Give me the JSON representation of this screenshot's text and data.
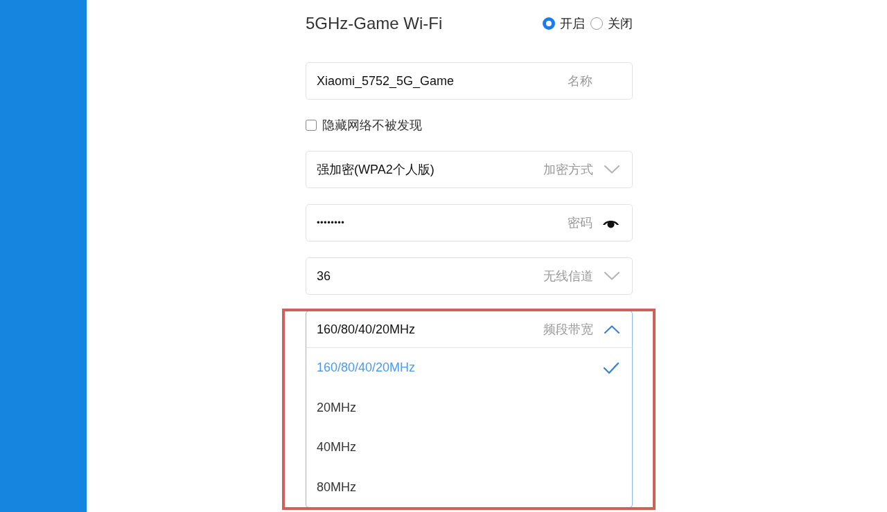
{
  "section": {
    "title": "5GHz-Game Wi-Fi",
    "power_options": [
      {
        "label": "开启",
        "selected": true
      },
      {
        "label": "关闭",
        "selected": false
      }
    ]
  },
  "network_name": {
    "value": "Xiaomi_5752_5G_Game",
    "label": "名称"
  },
  "hide_network": {
    "label": "隐藏网络不被发现",
    "checked": false
  },
  "encryption": {
    "value": "强加密(WPA2个人版)",
    "label": "加密方式",
    "expanded": false
  },
  "password": {
    "value": "••••••••",
    "label": "密码"
  },
  "channel": {
    "value": "36",
    "label": "无线信道",
    "expanded": false
  },
  "bandwidth": {
    "value": "160/80/40/20MHz",
    "label": "频段带宽",
    "expanded": true,
    "highlighted": true,
    "options": [
      {
        "label": "160/80/40/20MHz",
        "selected": true
      },
      {
        "label": "20MHz",
        "selected": false
      },
      {
        "label": "40MHz",
        "selected": false
      },
      {
        "label": "80MHz",
        "selected": false
      }
    ]
  }
}
